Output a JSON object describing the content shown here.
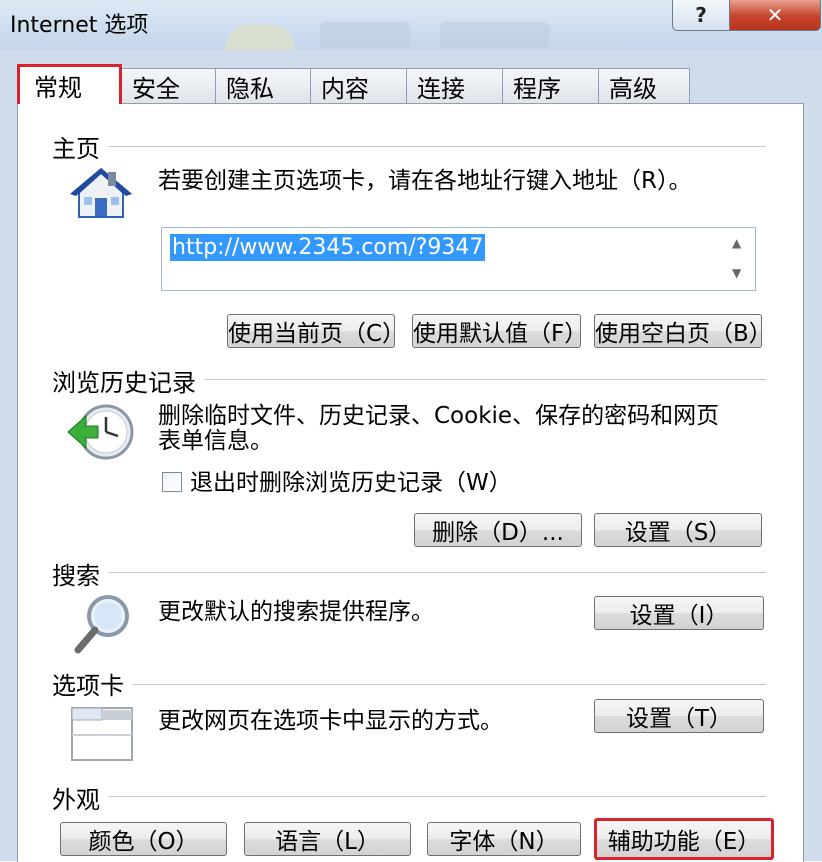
{
  "window": {
    "title": "Internet 选项",
    "help_label": "?",
    "close_label": "✕"
  },
  "tabs": [
    {
      "label": "常规",
      "active": true
    },
    {
      "label": "安全"
    },
    {
      "label": "隐私"
    },
    {
      "label": "内容"
    },
    {
      "label": "连接"
    },
    {
      "label": "程序"
    },
    {
      "label": "高级"
    }
  ],
  "homepage": {
    "heading": "主页",
    "description": "若要创建主页选项卡，请在各地址行键入地址（R）。",
    "url": "http://www.2345.com/?9347",
    "use_current": "使用当前页（C）",
    "use_default": "使用默认值（F）",
    "use_blank": "使用空白页（B）",
    "icon": "house-icon"
  },
  "history": {
    "heading": "浏览历史记录",
    "line1": "删除临时文件、历史记录、Cookie、保存的密码和网页",
    "line2": "表单信息。",
    "checkbox_label": "退出时删除浏览历史记录（W）",
    "checkbox_checked": false,
    "delete_button": "删除（D）...",
    "settings_button": "设置（S）",
    "icon": "clock-arrow-icon"
  },
  "search": {
    "heading": "搜索",
    "description": "更改默认的搜索提供程序。",
    "settings_button": "设置（I）",
    "icon": "magnifier-icon"
  },
  "tabs_section": {
    "heading": "选项卡",
    "description": "更改网页在选项卡中显示的方式。",
    "settings_button": "设置（T）",
    "icon": "tabs-window-icon"
  },
  "appearance": {
    "heading": "外观",
    "colors_button": "颜色（O）",
    "languages_button": "语言（L）",
    "fonts_button": "字体（N）",
    "accessibility_button": "辅助功能（E）"
  },
  "colors": {
    "highlight": "#d7242c",
    "selection": "#3399ff"
  }
}
